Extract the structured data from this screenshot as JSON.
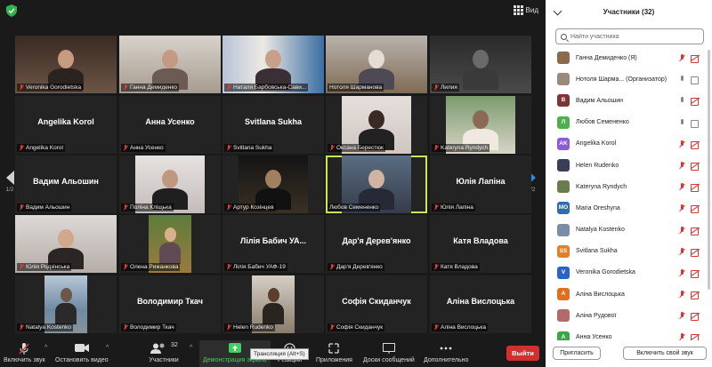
{
  "topbar": {
    "view_label": "Вид"
  },
  "grid": {
    "page_left": "1/2",
    "page_right": "1/2",
    "tiles": [
      {
        "label": "Veronika Gorodietska",
        "muted": true,
        "big": "",
        "video": "woman"
      },
      {
        "label": "Ганна Демиденко",
        "muted": true,
        "big": "",
        "video": "woman2"
      },
      {
        "label": "Наталя Барбовська-Сави...",
        "muted": true,
        "big": "",
        "video": "office"
      },
      {
        "label": "Нотоля Шарманова",
        "muted": false,
        "big": "",
        "video": "whitehair"
      },
      {
        "label": "Лилия",
        "muted": true,
        "big": "",
        "video": "dark"
      },
      {
        "label": "Angelika Korol",
        "muted": true,
        "big": "Angelika Korol",
        "video": ""
      },
      {
        "label": "Анна Усенко",
        "muted": true,
        "big": "Анна Усенко",
        "video": ""
      },
      {
        "label": "Svitlana Sukha",
        "muted": true,
        "big": "Svitlana Sukha",
        "video": ""
      },
      {
        "label": "Оксана Берестюк",
        "muted": true,
        "big": "",
        "video": "portrait"
      },
      {
        "label": "Kateryna Ryndych",
        "muted": true,
        "big": "",
        "video": "outdoor"
      },
      {
        "label": "Вадим Альошин",
        "muted": true,
        "big": "Вадим Альошин",
        "video": ""
      },
      {
        "label": "Поліна Кліщька",
        "muted": true,
        "big": "",
        "video": "girl"
      },
      {
        "label": "Артур Козінцев",
        "muted": true,
        "big": "",
        "video": "guitar"
      },
      {
        "label": "Любов Семененко",
        "muted": false,
        "big": "",
        "video": "older"
      },
      {
        "label": "Юлія Лапіна",
        "muted": true,
        "big": "Юлія Лапіна",
        "video": ""
      },
      {
        "label": "Юлія Родзінська",
        "muted": true,
        "big": "",
        "video": "girl2"
      },
      {
        "label": "Олена Рижанкова",
        "muted": true,
        "big": "",
        "video": "autumn"
      },
      {
        "label": "Лілія Бабич УАФ-19",
        "muted": true,
        "big": "Лілія Бабич УА...",
        "video": ""
      },
      {
        "label": "Дар'я Дерев'янко",
        "muted": true,
        "big": "Дар'я Дерев'янко",
        "video": ""
      },
      {
        "label": "Катя Владова",
        "muted": true,
        "big": "Катя Владова",
        "video": ""
      },
      {
        "label": "Natalya Kostenko",
        "muted": true,
        "big": "",
        "video": "sea"
      },
      {
        "label": "Володимир Ткач",
        "muted": true,
        "big": "Володимир Ткач",
        "video": ""
      },
      {
        "label": "Helen Rudenko",
        "muted": true,
        "big": "",
        "video": "helen"
      },
      {
        "label": "Софія Скиданчук",
        "muted": true,
        "big": "Софія Скиданчук",
        "video": ""
      },
      {
        "label": "Аліна Вислоцька",
        "muted": true,
        "big": "Аліна Вислоцька",
        "video": ""
      }
    ]
  },
  "toolbar": {
    "mute_label": "Включить звук",
    "video_label": "Остановить видео",
    "participants_label": "Участники",
    "participants_count": "32",
    "share_label": "Демонстрация экрана",
    "reactions_label": "Реакции",
    "apps_label": "Приложения",
    "board_label": "Доски сообщений",
    "more_label": "Дополнительно",
    "end_label": "Выйти",
    "tooltip": "Трансляция (Alt+S)"
  },
  "panel": {
    "title": "Участники (32)",
    "search_placeholder": "Найти участника",
    "participants": [
      {
        "name": "Ганна Демиденко (Я)",
        "avatar": "",
        "color": "#8a6a4a",
        "mic": false,
        "cam": false
      },
      {
        "name": "Нотоля Шарма... (Организатор)",
        "avatar": "",
        "color": "#9a8a7a",
        "mic": true,
        "cam": true
      },
      {
        "name": "Вадим Альошин",
        "avatar": "В",
        "color": "#7b3535",
        "mic": true,
        "cam": false
      },
      {
        "name": "Любов Семененко",
        "avatar": "Л",
        "color": "#4fae4f",
        "mic": true,
        "cam": true
      },
      {
        "name": "Angelika Korol",
        "avatar": "AK",
        "color": "#8c5bd6",
        "mic": false,
        "cam": false
      },
      {
        "name": "Helen Rudenko",
        "avatar": "",
        "color": "#3a3f55",
        "mic": false,
        "cam": false
      },
      {
        "name": "Kateryna Ryndych",
        "avatar": "",
        "color": "#6b7b50",
        "mic": false,
        "cam": false
      },
      {
        "name": "Maria Oreshyna",
        "avatar": "MO",
        "color": "#2f6ea8",
        "mic": false,
        "cam": false
      },
      {
        "name": "Natalya Kostenko",
        "avatar": "",
        "color": "#7a8ca6",
        "mic": false,
        "cam": false
      },
      {
        "name": "Svitlana Sukha",
        "avatar": "SS",
        "color": "#e0802a",
        "mic": false,
        "cam": false
      },
      {
        "name": "Veronika Gorodietska",
        "avatar": "V",
        "color": "#2a62c7",
        "mic": false,
        "cam": false
      },
      {
        "name": "Аліна Вислоцька",
        "avatar": "А",
        "color": "#e07020",
        "mic": false,
        "cam": false
      },
      {
        "name": "Аліна Рудової",
        "avatar": "",
        "color": "#b56a6a",
        "mic": false,
        "cam": false
      },
      {
        "name": "Анна Усенко",
        "avatar": "А",
        "color": "#3ca64a",
        "mic": false,
        "cam": false
      }
    ],
    "invite_label": "Пригласить",
    "unmute_label": "Включить свой звук"
  }
}
